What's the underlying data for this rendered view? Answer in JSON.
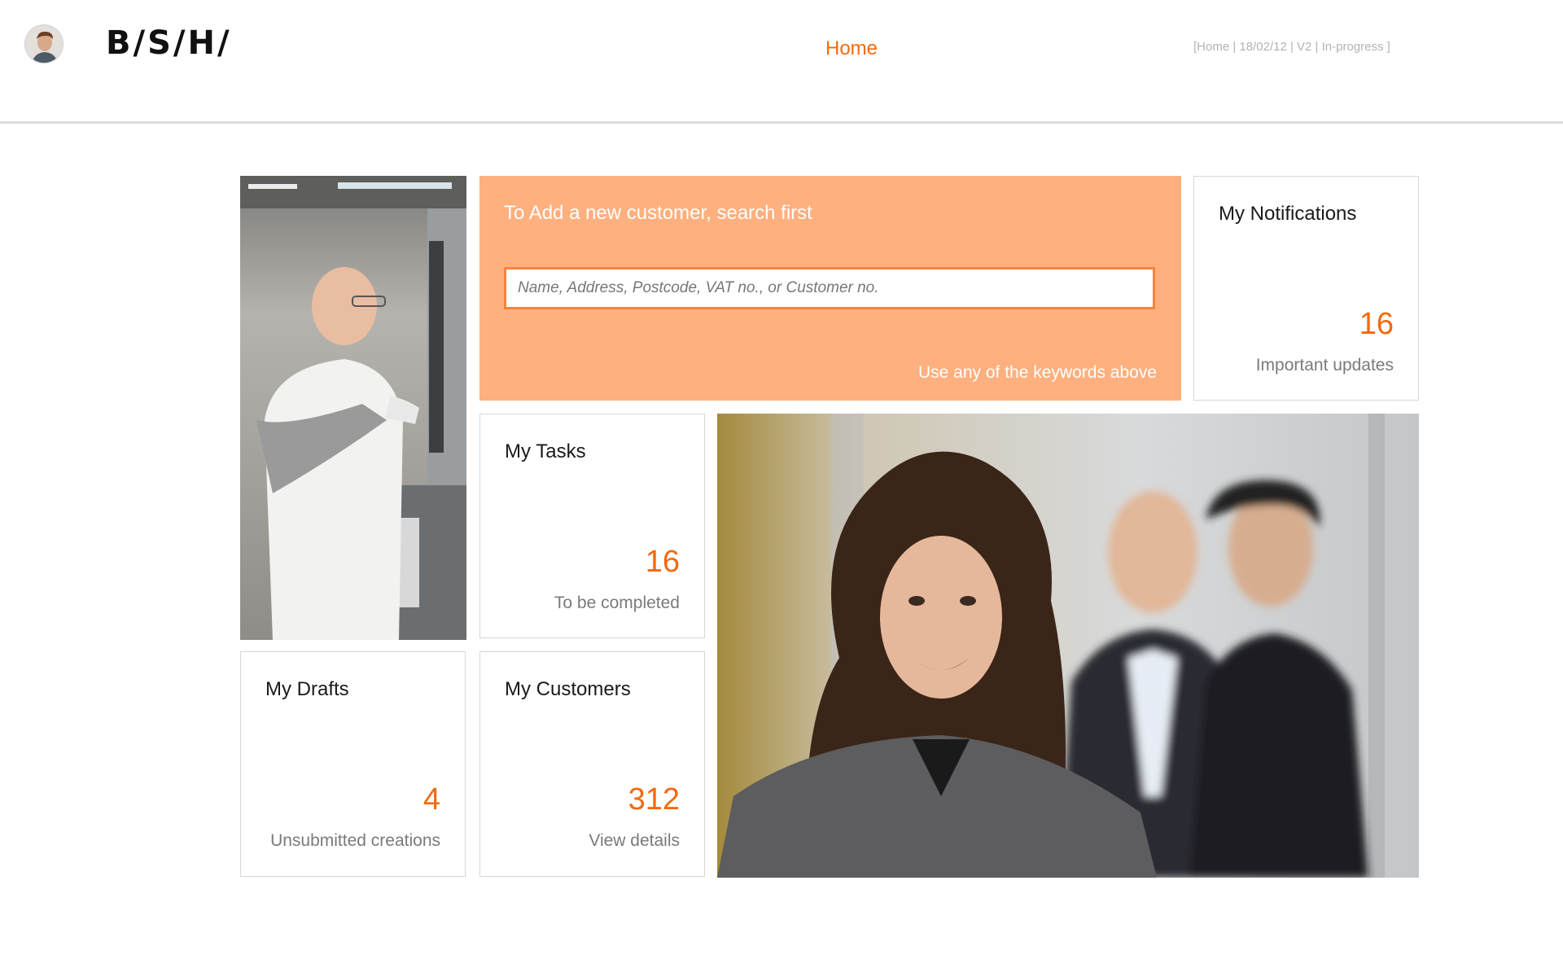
{
  "header": {
    "logo": "B/S/H/",
    "nav_home": "Home",
    "meta": "[Home | 18/02/12 | V2 | In-progress ]"
  },
  "search": {
    "title": "To Add a new customer, search first",
    "placeholder": "Name, Address, Postcode, VAT no., or Customer no.",
    "hint": "Use any of the keywords above"
  },
  "notifications": {
    "title": "My Notifications",
    "count": "16",
    "subtitle": "Important updates"
  },
  "tasks": {
    "title": "My Tasks",
    "count": "16",
    "subtitle": "To be completed"
  },
  "drafts": {
    "title": "My Drafts",
    "count": "4",
    "subtitle": "Unsubmitted creations"
  },
  "customers": {
    "title": "My Customers",
    "count": "312",
    "subtitle": "View details"
  },
  "colors": {
    "accent": "#f26a10",
    "search_bg": "#ffb07e",
    "search_border": "#f7843c"
  }
}
